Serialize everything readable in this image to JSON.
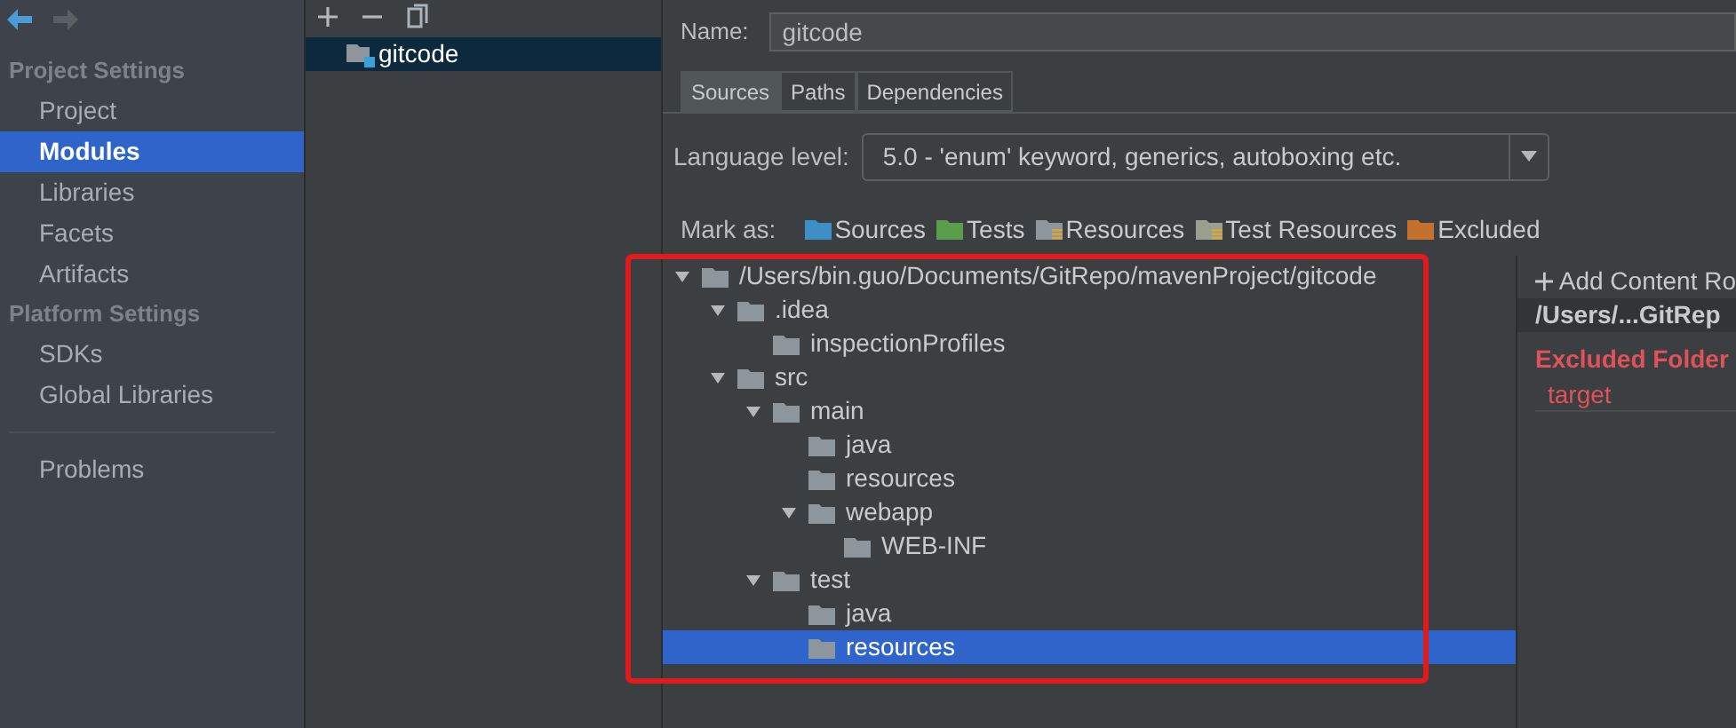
{
  "sidebar": {
    "sections": [
      {
        "title": "Project Settings",
        "items": [
          {
            "label": "Project",
            "selected": false
          },
          {
            "label": "Modules",
            "selected": true
          },
          {
            "label": "Libraries",
            "selected": false
          },
          {
            "label": "Facets",
            "selected": false
          },
          {
            "label": "Artifacts",
            "selected": false
          }
        ]
      },
      {
        "title": "Platform Settings",
        "items": [
          {
            "label": "SDKs",
            "selected": false
          },
          {
            "label": "Global Libraries",
            "selected": false
          }
        ]
      },
      {
        "items": [
          {
            "label": "Problems",
            "selected": false
          }
        ]
      }
    ]
  },
  "modules": [
    {
      "name": "gitcode",
      "selected": true
    }
  ],
  "details": {
    "name_label": "Name:",
    "name_value": "gitcode",
    "tabs": [
      {
        "label": "Sources",
        "selected": true
      },
      {
        "label": "Paths",
        "selected": false
      },
      {
        "label": "Dependencies",
        "selected": false
      }
    ],
    "language_level": {
      "label": "Language level:",
      "value": "5.0 - 'enum' keyword, generics, autoboxing etc."
    },
    "mark_as": {
      "label": "Mark as:",
      "marks": [
        {
          "label": "Sources",
          "kind": "folder",
          "color": "#3d8fc6"
        },
        {
          "label": "Tests",
          "kind": "folder",
          "color": "#5a9e4b"
        },
        {
          "label": "Resources",
          "kind": "resource-folder",
          "color": "#8d969c"
        },
        {
          "label": "Test Resources",
          "kind": "resource-folder",
          "color": "#9aa08f"
        },
        {
          "label": "Excluded",
          "kind": "folder",
          "color": "#c4712f"
        }
      ]
    },
    "tree": {
      "label": "/Users/bin.guo/Documents/GitRepo/mavenProject/gitcode",
      "expanded": true,
      "selected": false,
      "children": [
        {
          "label": ".idea",
          "expanded": true,
          "selected": false,
          "children": [
            {
              "label": "inspectionProfiles",
              "selected": false
            }
          ]
        },
        {
          "label": "src",
          "expanded": true,
          "selected": false,
          "children": [
            {
              "label": "main",
              "expanded": true,
              "selected": false,
              "children": [
                {
                  "label": "java",
                  "selected": false
                },
                {
                  "label": "resources",
                  "selected": false
                },
                {
                  "label": "webapp",
                  "expanded": true,
                  "selected": false,
                  "children": [
                    {
                      "label": "WEB-INF",
                      "selected": false
                    }
                  ]
                }
              ]
            },
            {
              "label": "test",
              "expanded": true,
              "selected": false,
              "children": [
                {
                  "label": "java",
                  "selected": false
                },
                {
                  "label": "resources",
                  "selected": true
                }
              ]
            }
          ]
        }
      ]
    },
    "content_root": {
      "add_label": "Add Content Ro",
      "path": "/Users/...GitRep",
      "excluded_title": "Excluded Folder",
      "excluded": [
        "target"
      ]
    }
  }
}
